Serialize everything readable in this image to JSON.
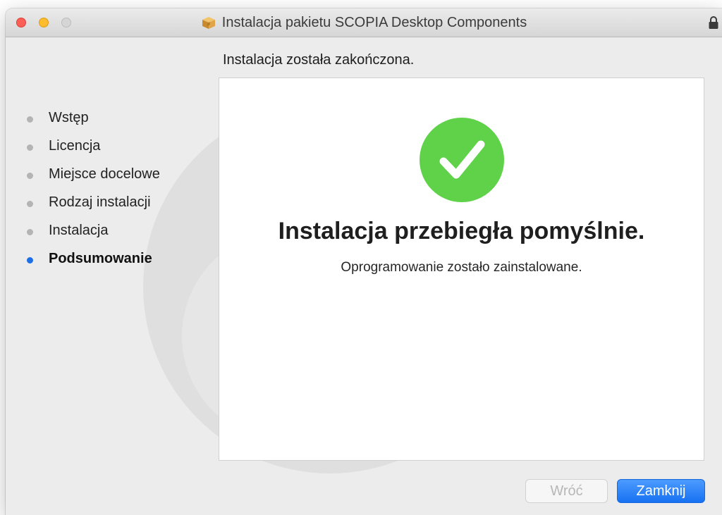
{
  "window": {
    "title": "Instalacja pakietu SCOPIA Desktop Components",
    "title_icon": "package-icon",
    "lock_icon": "lock-icon"
  },
  "subtitle": "Instalacja została zakończona.",
  "steps": [
    {
      "label": "Wstęp",
      "active": false
    },
    {
      "label": "Licencja",
      "active": false
    },
    {
      "label": "Miejsce docelowe",
      "active": false
    },
    {
      "label": "Rodzaj instalacji",
      "active": false
    },
    {
      "label": "Instalacja",
      "active": false
    },
    {
      "label": "Podsumowanie",
      "active": true
    }
  ],
  "content": {
    "status_icon": "checkmark-icon",
    "headline": "Instalacja przebiegła pomyślnie.",
    "message": "Oprogramowanie zostało zainstalowane."
  },
  "buttons": {
    "back_label": "Wróć",
    "back_enabled": false,
    "close_label": "Zamknij"
  },
  "colors": {
    "accent": "#1d6fe8",
    "success": "#5fd24a",
    "window_bg": "#ececec"
  }
}
